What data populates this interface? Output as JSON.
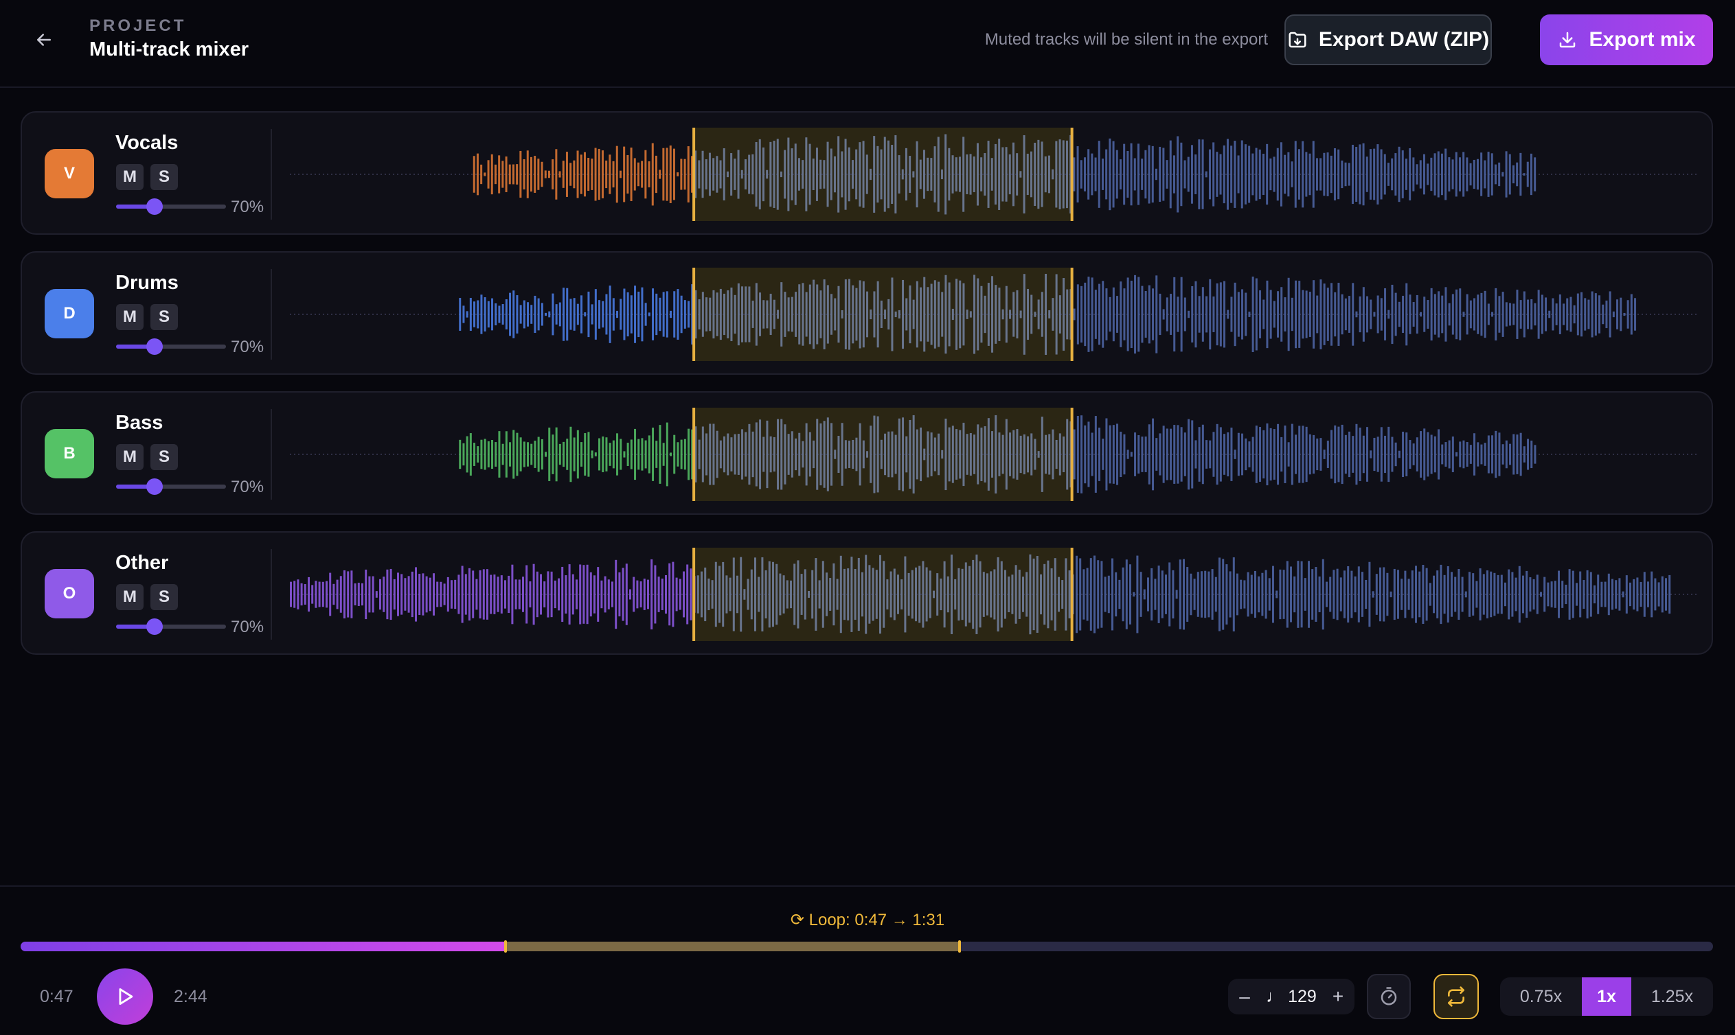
{
  "header": {
    "project_label": "PROJECT",
    "project_title": "Multi-track mixer",
    "mute_note": "Muted tracks will be silent in the export",
    "export_daw_label": "Export DAW (ZIP)",
    "export_mix_label": "Export mix",
    "back_icon": "arrow-left-icon",
    "daw_icon": "folder-export-icon",
    "mix_icon": "download-icon"
  },
  "tracks": [
    {
      "name": "Vocals",
      "initial": "V",
      "color": "#e47a35",
      "mute_label": "M",
      "solo_label": "S",
      "volume": 0.7,
      "volume_label": "70%",
      "start": 0.13,
      "end": 0.885
    },
    {
      "name": "Drums",
      "initial": "D",
      "color": "#4b7fea",
      "mute_label": "M",
      "solo_label": "S",
      "volume": 0.7,
      "volume_label": "70%",
      "start": 0.12,
      "end": 0.955
    },
    {
      "name": "Bass",
      "initial": "B",
      "color": "#55c266",
      "mute_label": "M",
      "solo_label": "S",
      "volume": 0.7,
      "volume_label": "70%",
      "start": 0.12,
      "end": 0.885
    },
    {
      "name": "Other",
      "initial": "O",
      "color": "#8f5ae8",
      "mute_label": "M",
      "solo_label": "S",
      "volume": 0.7,
      "volume_label": "70%",
      "start": 0.0,
      "end": 0.98
    }
  ],
  "waveform_colors": {
    "played_other": "#4a5f9a",
    "loop_region_bg": "#2b2614",
    "loop_bar": "#6b7892",
    "loop_handle": "#e7b040"
  },
  "transport": {
    "loop_label": "⟳ Loop: 0:47 → 1:31",
    "current_time": "0:47",
    "total_time": "2:44",
    "progress": 0.2866,
    "loop_start": 0.2866,
    "loop_end": 0.5549,
    "bpm_minus": "–",
    "bpm_value": "♩ 129",
    "bpm_plus": "+",
    "metronome_icon": "metronome-timer-icon",
    "loop_icon": "loop-repeat-icon",
    "play_icon": "play-icon",
    "speeds": [
      "0.75x",
      "1x",
      "1.25x"
    ],
    "active_speed": "1x"
  }
}
